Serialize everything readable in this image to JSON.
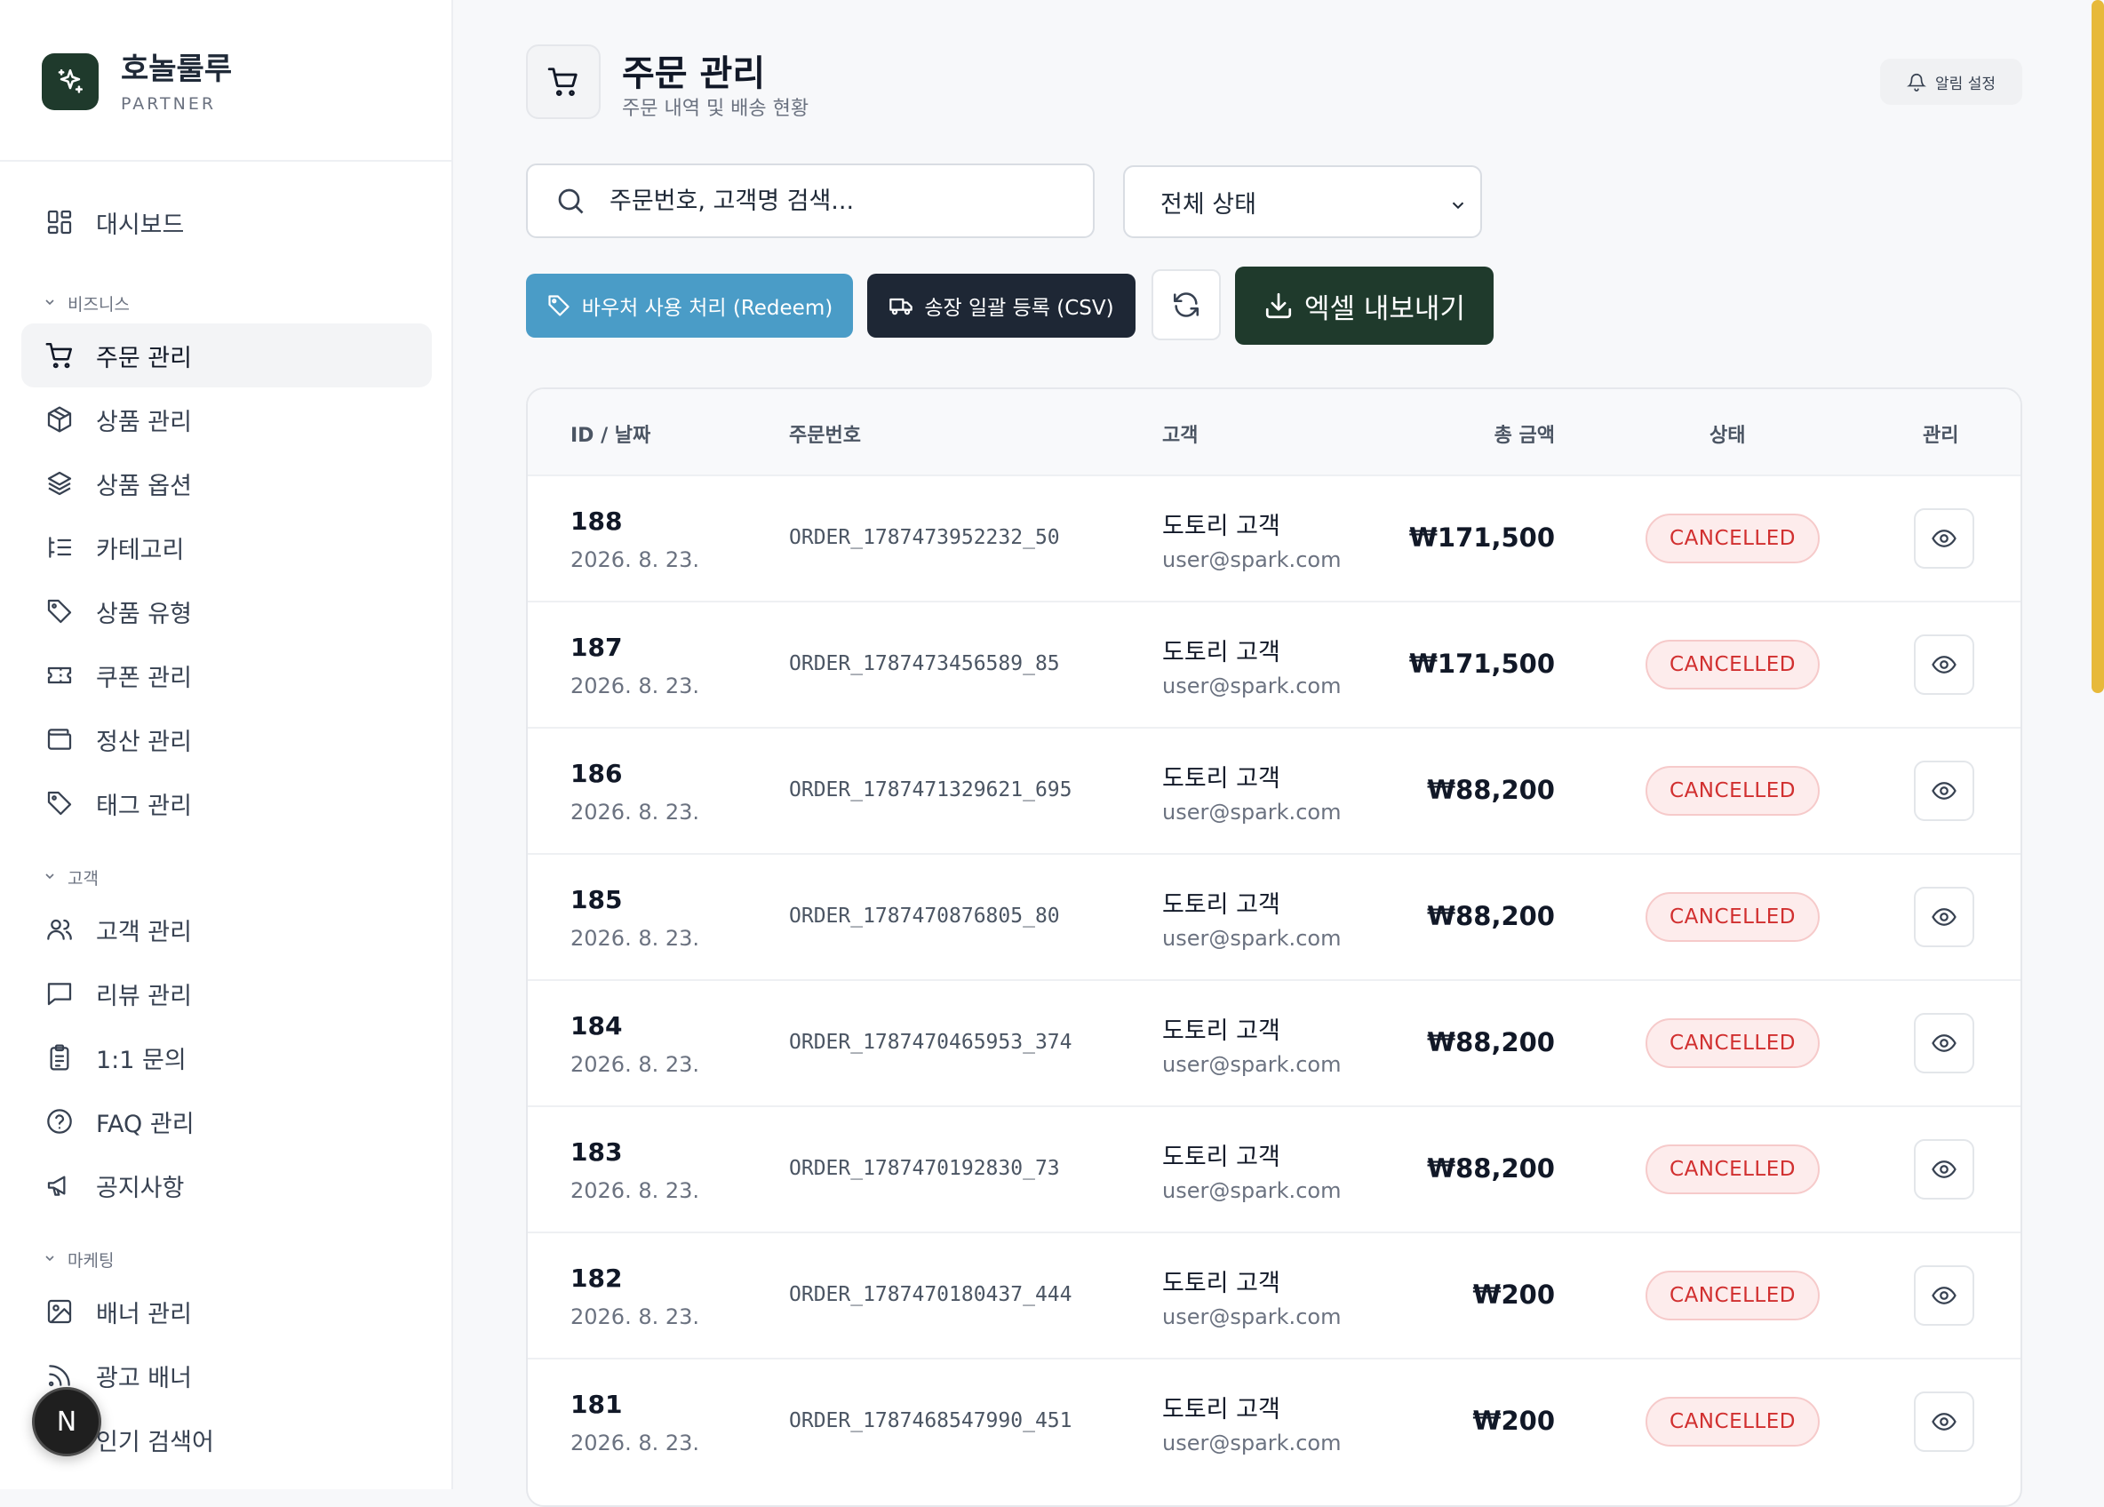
{
  "brand": {
    "name": "호놀룰루",
    "sub": "PARTNER"
  },
  "sidebar": {
    "dashboard": "대시보드",
    "sections": [
      {
        "title": "비즈니스"
      },
      {
        "title": "고객"
      },
      {
        "title": "마케팅"
      }
    ],
    "items": [
      {
        "label": "주문 관리",
        "icon": "cart-icon"
      },
      {
        "label": "상품 관리",
        "icon": "box-icon"
      },
      {
        "label": "상품 옵션",
        "icon": "layers-icon"
      },
      {
        "label": "카테고리",
        "icon": "list-tree-icon"
      },
      {
        "label": "상품 유형",
        "icon": "tag-icon"
      },
      {
        "label": "쿠폰 관리",
        "icon": "ticket-icon"
      },
      {
        "label": "정산 관리",
        "icon": "wallet-icon"
      },
      {
        "label": "태그 관리",
        "icon": "tag-icon"
      },
      {
        "label": "고객 관리",
        "icon": "users-icon"
      },
      {
        "label": "리뷰 관리",
        "icon": "message-icon"
      },
      {
        "label": "1:1 문의",
        "icon": "clipboard-icon"
      },
      {
        "label": "FAQ 관리",
        "icon": "help-circle-icon"
      },
      {
        "label": "공지사항",
        "icon": "megaphone-icon"
      },
      {
        "label": "배너 관리",
        "icon": "image-icon"
      },
      {
        "label": "광고 배너",
        "icon": "rss-icon"
      },
      {
        "label": "인기 검색어",
        "icon": "search-icon"
      }
    ],
    "badge": "N"
  },
  "header": {
    "title": "주문 관리",
    "subtitle": "주문 내역 및 배송 현황",
    "notify_label": "알림 설정"
  },
  "toolbar": {
    "search_placeholder": "주문번호, 고객명 검색...",
    "status_select": "전체 상태",
    "redeem_label": "바우처 사용 처리 (Redeem)",
    "csv_label": "송장 일괄 등록 (CSV)",
    "export_label": "엑셀 내보내기"
  },
  "table": {
    "headers": {
      "id": "ID / 날짜",
      "order": "주문번호",
      "customer": "고객",
      "amount": "총 금액",
      "status": "상태",
      "manage": "관리"
    },
    "rows": [
      {
        "id": "188",
        "date": "2026. 8. 23.",
        "order": "ORDER_1787473952232_50",
        "name": "도토리 고객",
        "email": "user@spark.com",
        "amount": "₩171,500",
        "status": "CANCELLED"
      },
      {
        "id": "187",
        "date": "2026. 8. 23.",
        "order": "ORDER_1787473456589_85",
        "name": "도토리 고객",
        "email": "user@spark.com",
        "amount": "₩171,500",
        "status": "CANCELLED"
      },
      {
        "id": "186",
        "date": "2026. 8. 23.",
        "order": "ORDER_1787471329621_695",
        "name": "도토리 고객",
        "email": "user@spark.com",
        "amount": "₩88,200",
        "status": "CANCELLED"
      },
      {
        "id": "185",
        "date": "2026. 8. 23.",
        "order": "ORDER_1787470876805_80",
        "name": "도토리 고객",
        "email": "user@spark.com",
        "amount": "₩88,200",
        "status": "CANCELLED"
      },
      {
        "id": "184",
        "date": "2026. 8. 23.",
        "order": "ORDER_1787470465953_374",
        "name": "도토리 고객",
        "email": "user@spark.com",
        "amount": "₩88,200",
        "status": "CANCELLED"
      },
      {
        "id": "183",
        "date": "2026. 8. 23.",
        "order": "ORDER_1787470192830_73",
        "name": "도토리 고객",
        "email": "user@spark.com",
        "amount": "₩88,200",
        "status": "CANCELLED"
      },
      {
        "id": "182",
        "date": "2026. 8. 23.",
        "order": "ORDER_1787470180437_444",
        "name": "도토리 고객",
        "email": "user@spark.com",
        "amount": "₩200",
        "status": "CANCELLED"
      },
      {
        "id": "181",
        "date": "2026. 8. 23.",
        "order": "ORDER_1787468547990_451",
        "name": "도토리 고객",
        "email": "user@spark.com",
        "amount": "₩200",
        "status": "CANCELLED"
      }
    ]
  },
  "colors": {
    "brand": "#1f3a2c",
    "accent": "#4a9cc7",
    "dark": "#1e2735",
    "cancelled": "#d12f2f"
  }
}
